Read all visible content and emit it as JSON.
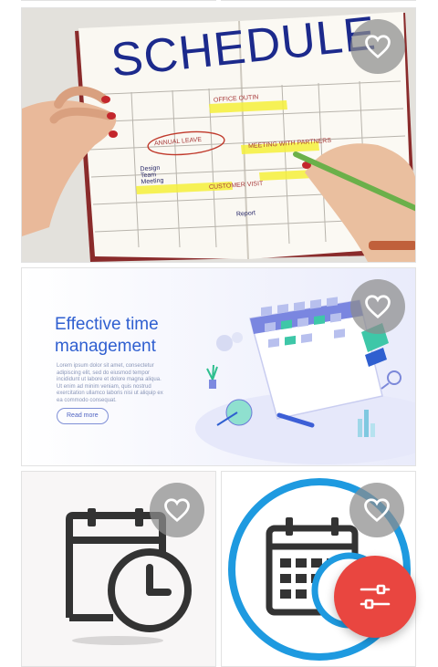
{
  "cards": [
    {
      "kind": "schedule-photo",
      "heading": "SCHEDULE",
      "notes": [
        "OFFICE OUTIN",
        "ANNUAL LEAVE",
        "MEETING WITH PARTNERS",
        "CUSTOMER VISIT",
        "Design Team Meeting",
        "Report"
      ],
      "favorite_icon": "heart-outline-icon"
    },
    {
      "kind": "illustration-ad",
      "title_line1": "Effective time",
      "title_line2": "management",
      "lorem": "Lorem ipsum dolor sit amet, consectetur adipiscing elit, sed do eiusmod tempor incididunt ut labore et dolore magna aliqua. Ut enim ad minim veniam, quis nostrud exercitation ullamco laboris nisi ut aliquip ex ea commodo consequat.",
      "read_more": "Read more",
      "favorite_icon": "heart-outline-icon"
    },
    {
      "kind": "calendar-clock-icon",
      "favorite_icon": "heart-outline-icon"
    },
    {
      "kind": "calendar-circle-icon",
      "favorite_icon": "heart-outline-icon"
    }
  ],
  "fab": {
    "icon": "filter-sliders-icon",
    "color": "#e94640"
  },
  "colors": {
    "accent_blue": "#2f5fd0",
    "favorite_bg": "#8c8c8c",
    "circle_blue": "#1e9ae0"
  }
}
